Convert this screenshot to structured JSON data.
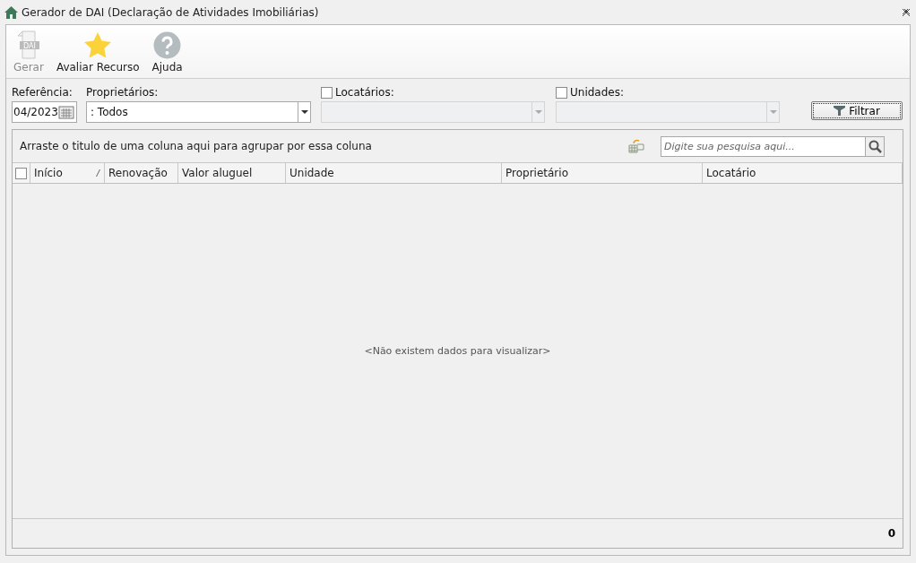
{
  "window": {
    "title": "Gerador de DAI (Declaração de Atividades Imobiliárias)"
  },
  "toolbar": [
    {
      "kind": "dai",
      "label": "Gerar",
      "disabled": true,
      "icon_text": "DAI"
    },
    {
      "kind": "star",
      "label": "Avaliar Recurso",
      "disabled": false
    },
    {
      "kind": "help",
      "label": "Ajuda",
      "disabled": false
    }
  ],
  "filters": {
    "referencia": {
      "label": "Referência:",
      "value": "04/2023"
    },
    "proprietarios": {
      "label": "Proprietários:",
      "value": ": Todos",
      "disabled": false
    },
    "locatarios": {
      "label": "Locatários:",
      "checked": false,
      "disabled": true
    },
    "unidades": {
      "label": "Unidades:",
      "checked": false,
      "disabled": true
    },
    "filter_button": "Filtrar"
  },
  "grid": {
    "group_hint": "Arraste o titulo de uma coluna aqui para agrupar por essa coluna",
    "search": {
      "placeholder": "Digite sua pesquisa aqui..."
    },
    "select_all": {
      "checked": false
    },
    "columns": [
      {
        "label": "Início",
        "sorted": true
      },
      {
        "label": "Renovação",
        "sorted": false
      },
      {
        "label": "Valor aluguel",
        "sorted": false
      },
      {
        "label": "Unidade",
        "sorted": false
      },
      {
        "label": "Proprietário",
        "sorted": false
      },
      {
        "label": "Locatário",
        "sorted": false
      }
    ],
    "empty_message": "<Não existem dados para visualizar>",
    "footer_count": "0"
  }
}
